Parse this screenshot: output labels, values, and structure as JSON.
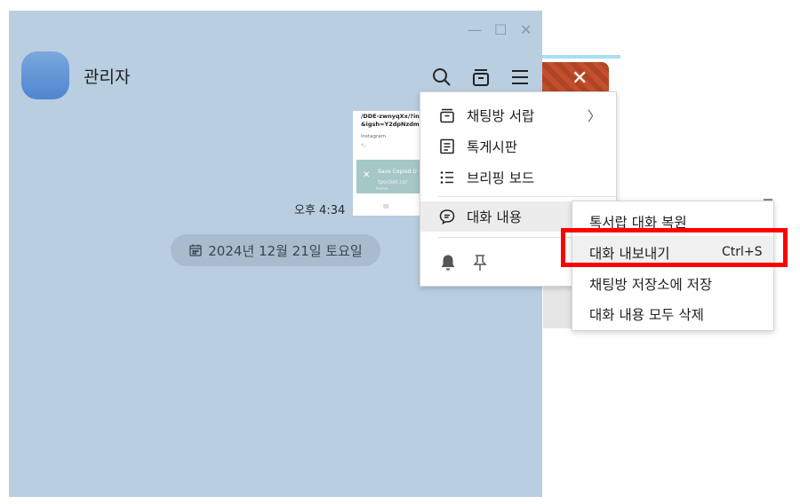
{
  "window": {
    "controls": {
      "minimize": "—",
      "maximize": "☐",
      "close": "✕"
    }
  },
  "header": {
    "title": "관리자"
  },
  "attachment": {
    "line1": "/DDE-zwnyqXx/?in",
    "line2": "&igsh=Y2dpNzdmN",
    "source": "Instagram",
    "tag": "🏷  ",
    "toast_close": "✕",
    "toast_text": "Save Copied U",
    "toast_site": "tpocket.cor",
    "toast_home": "Home",
    "nav": "III"
  },
  "messages": {
    "time": "오후 4:34"
  },
  "date_divider": {
    "label": "2024년 12월 21일 토요일"
  },
  "background": {
    "close_glyph": "✕"
  },
  "main_menu": {
    "items": [
      {
        "label": "채팅방 서랍",
        "arrow": "〉"
      },
      {
        "label": "톡게시판"
      },
      {
        "label": "브리핑 보드"
      },
      {
        "label": "대화 내용"
      }
    ]
  },
  "sub_menu": {
    "items": [
      {
        "label": "톡서랍 대화 복원"
      },
      {
        "label": "대화 내보내기",
        "shortcut": "Ctrl+S"
      },
      {
        "label": "채팅방 저장소에 저장"
      },
      {
        "label": "대화 내용 모두 삭제"
      }
    ]
  },
  "colors": {
    "chat_background": "#b9cee0",
    "highlight_box": "#ff0000",
    "avatar": "#5b8fd4"
  }
}
